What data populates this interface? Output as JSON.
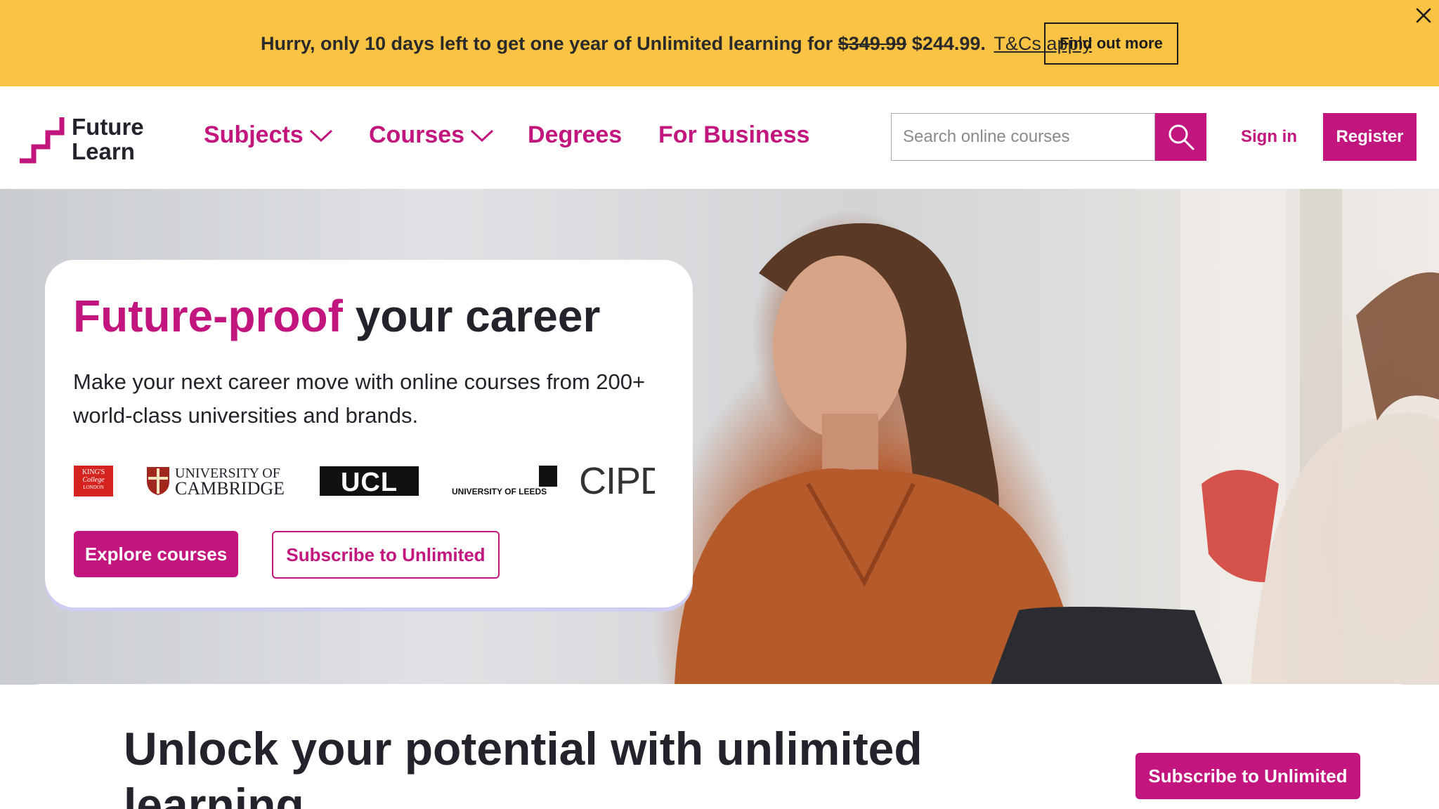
{
  "promo": {
    "text_before": "Hurry, only 10 days left to get one year of Unlimited learning for",
    "old_price": "$349.99",
    "new_price": "$244.99.",
    "tcs_link": "T&Cs apply",
    "cta": "Find out more",
    "close_icon": "close-icon",
    "background": "#fbc343"
  },
  "header": {
    "logo": {
      "line1": "Future",
      "line2": "Learn"
    },
    "nav": [
      {
        "label": "Subjects",
        "has_dropdown": true
      },
      {
        "label": "Courses",
        "has_dropdown": true
      },
      {
        "label": "Degrees",
        "has_dropdown": false
      },
      {
        "label": "For Business",
        "has_dropdown": false
      }
    ],
    "search": {
      "placeholder": "Search online courses",
      "value": "",
      "icon": "search-icon"
    },
    "sign_in": "Sign in",
    "register": "Register"
  },
  "hero": {
    "title_accent": "Future-proof",
    "title_rest": " your career",
    "subtitle": "Make your next career move with online courses from 200+ world-class universities and brands.",
    "partners": [
      {
        "name": "King's College London",
        "line1": "KING'S",
        "line2": "College",
        "line3": "LONDON"
      },
      {
        "name": "University of Cambridge",
        "line1": "UNIVERSITY OF",
        "line2": "CAMBRIDGE"
      },
      {
        "name": "UCL",
        "text": "UCL"
      },
      {
        "name": "University of Leeds",
        "text": "UNIVERSITY OF LEEDS"
      },
      {
        "name": "CIPD",
        "text": "CIPD"
      }
    ],
    "primary_cta": "Explore courses",
    "secondary_cta": "Subscribe to Unlimited"
  },
  "unlock": {
    "title": "Unlock your potential with unlimited learning",
    "cta": "Subscribe to Unlimited"
  },
  "colors": {
    "brand": "#c2157d",
    "text": "#23232b",
    "banner": "#fbc343"
  }
}
